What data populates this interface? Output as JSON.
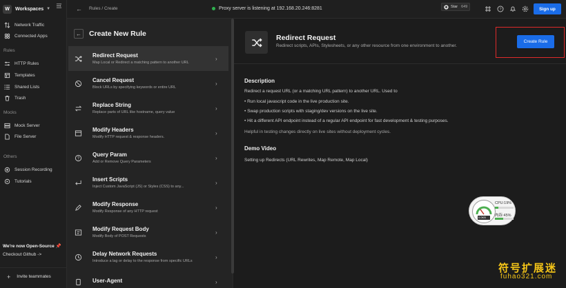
{
  "sidebar": {
    "workspace_badge": "W",
    "workspace_label": "Workspaces",
    "items_top": [
      {
        "label": "Network Traffic"
      },
      {
        "label": "Connected Apps"
      }
    ],
    "section_rules": "Rules",
    "items_rules": [
      {
        "label": "HTTP Rules"
      },
      {
        "label": "Templates"
      },
      {
        "label": "Shared Lists"
      },
      {
        "label": "Trash"
      }
    ],
    "section_mocks": "Mocks",
    "items_mocks": [
      {
        "label": "Mock Server"
      },
      {
        "label": "File Server"
      }
    ],
    "section_others": "Others",
    "items_others": [
      {
        "label": "Session Recording"
      },
      {
        "label": "Tutorials"
      }
    ],
    "open_source": "We're now Open-Source",
    "checkout": "Checkout Github ->",
    "invite": "Invite teammates"
  },
  "topbar": {
    "breadcrumb": "Rules / Create",
    "proxy_status": "Proxy server is listening at 192.168.20.246:8281",
    "proxy_color": "#2fb14f",
    "star_label": "Star",
    "star_count": "649",
    "signup_label": "Sign up"
  },
  "panel": {
    "title": "Create New Rule",
    "rules": [
      {
        "name": "Redirect Request",
        "desc": "Map Local or Redirect a matching pattern to another URL",
        "icon": "shuffle-icon"
      },
      {
        "name": "Cancel Request",
        "desc": "Block URLs by specifying keywords or entire URL",
        "icon": "block-icon"
      },
      {
        "name": "Replace String",
        "desc": "Replace parts of URL like hostname, query value",
        "icon": "swap-icon"
      },
      {
        "name": "Modify Headers",
        "desc": "Modify HTTP request & response headers.",
        "icon": "window-icon"
      },
      {
        "name": "Query Param",
        "desc": "Add or Remove Query Parameters",
        "icon": "question-icon"
      },
      {
        "name": "Insert Scripts",
        "desc": "Inject Custom JavaScript (JS) or Styles (CSS) to any...",
        "icon": "enter-icon"
      },
      {
        "name": "Modify Response",
        "desc": "Modify Response of any HTTP request",
        "icon": "pencil-icon"
      },
      {
        "name": "Modify Request Body",
        "desc": "Modify Body of POST Requests",
        "icon": "code-icon"
      },
      {
        "name": "Delay Network Requests",
        "desc": "Introduce a lag or delay to the response from specific URLs",
        "icon": "clock-icon"
      },
      {
        "name": "User-Agent",
        "desc": "",
        "icon": "device-icon"
      }
    ]
  },
  "detail": {
    "title": "Redirect Request",
    "subtitle": "Redirect scripts, APIs, Stylesheets, or any other resource from one environment to another.",
    "create_label": "Create Rule",
    "description_heading": "Description",
    "description": "Redirect a request URL (or a matching URL pattern) to another URL. Used to",
    "bullets": [
      "Run local javascript code in the live production site.",
      "Swap production scripts with staging/dev versions on the live site.",
      "Hit a different API endpoint instead of a regular API endpoint for fast development & testing purposes."
    ],
    "helpful": "Helpful in testing changes directly on live sites without deployment cycles.",
    "demo_heading": "Demo Video",
    "demo_text": "Setting up Redirects (URL Rewrites, Map Remote, Map Local)"
  },
  "widget": {
    "cpu_label": "CPU:19%",
    "cpu_fraction": 0.19,
    "mem_label": "内存:45%",
    "mem_fraction": 0.45,
    "speed_label": "0.0KB"
  },
  "watermark": {
    "line1": "符号扩展迷",
    "line2": "fuhao321.com"
  },
  "colors": {
    "accent": "#1a6ce8",
    "highlight": "#e02a2a"
  }
}
